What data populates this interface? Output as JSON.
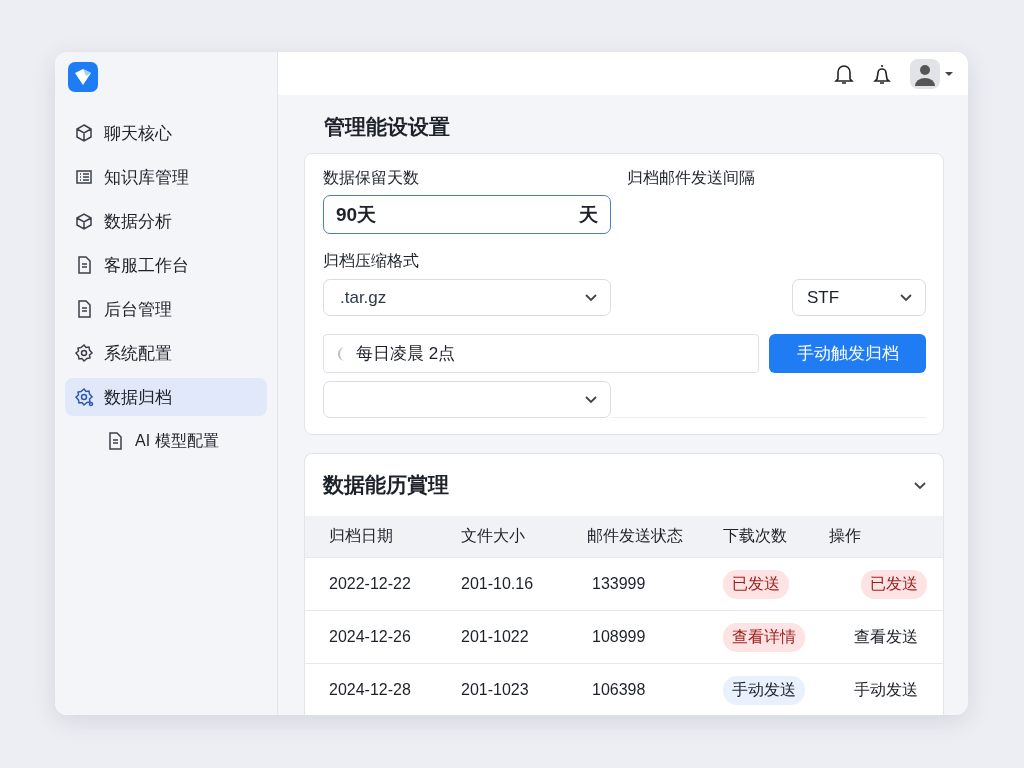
{
  "sidebar": {
    "items": [
      {
        "label": "聊天核心",
        "selected": false
      },
      {
        "label": "知识库管理",
        "selected": false
      },
      {
        "label": "数据分析",
        "selected": false
      },
      {
        "label": "客服工作台",
        "selected": false
      },
      {
        "label": "后台管理",
        "selected": false
      },
      {
        "label": "系统配置",
        "selected": false
      },
      {
        "label": "数据归档",
        "selected": true,
        "children": [
          {
            "label": "AI 模型配置",
            "selected": false
          }
        ]
      }
    ]
  },
  "page_title": "管理能设设置",
  "settings": {
    "retention": {
      "label": "数据保留天数",
      "value": "90天",
      "suffix": "天"
    },
    "interval": {
      "label": "归档邮件发送间隔"
    },
    "format": {
      "label": "归档压缩格式",
      "value": ".tar.gz"
    },
    "type_select": {
      "value": "STF"
    },
    "schedule": {
      "value": "每日凌晨 2点"
    },
    "trigger_button": "手动触发归档"
  },
  "history": {
    "title": "数据能历賞理",
    "expanded": true,
    "columns": [
      "归档日期",
      "文件大小",
      "邮件发送状态",
      "下载次数",
      "操作"
    ],
    "rows": [
      {
        "date": "2022-12-22",
        "size": "201-10.16",
        "status": "133999",
        "downloads": {
          "text": "已发送",
          "kind": "danger"
        },
        "action": {
          "text": "已发送",
          "kind": "danger"
        }
      },
      {
        "date": "2024-12-26",
        "size": "201-1022",
        "status": "108999",
        "downloads": {
          "text": "查看详情",
          "kind": "danger"
        },
        "action": {
          "text": "查看发送",
          "kind": "plain"
        }
      },
      {
        "date": "2024-12-28",
        "size": "201-1023",
        "status": "106398",
        "downloads": {
          "text": "手动发送",
          "kind": "info"
        },
        "action": {
          "text": "手动发送",
          "kind": "plain"
        }
      }
    ]
  }
}
